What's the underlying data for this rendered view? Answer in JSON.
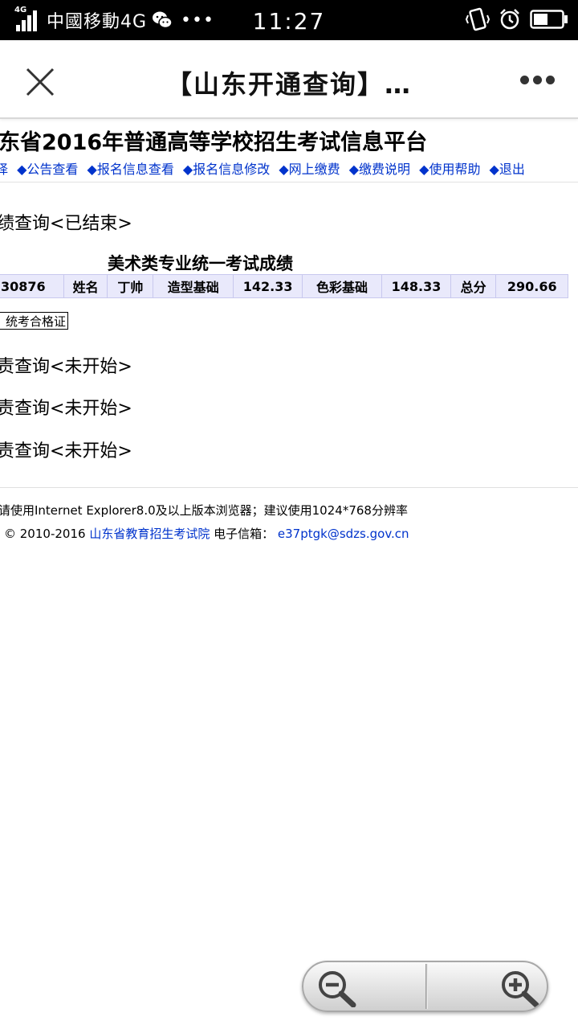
{
  "status_bar": {
    "network_tag": "4G",
    "carrier": "中國移動4G",
    "time": "11:27",
    "icons": [
      "signal-icon",
      "wechat-icon",
      "more-notifications-icon",
      "vibrate-icon",
      "alarm-icon",
      "battery-icon"
    ],
    "battery_level": 0.5
  },
  "title_bar": {
    "title": "【山东开通查询】…",
    "close_icon": "close-icon",
    "menu_icon": "more-icon"
  },
  "page": {
    "site_title": "东省2016年普通高等学校招生考试信息平台",
    "nav": [
      "择",
      "◆公告查看",
      "◆报名信息查看",
      "◆报名信息修改",
      "◆网上缴费",
      "◆缴费说明",
      "◆使用帮助",
      "◆退出"
    ],
    "section1_title": "绩查询<已结束>",
    "score_caption": "美术类专业统一考试成绩",
    "score_row": [
      "30876",
      "姓名",
      "丁帅",
      "造型基础",
      "142.33",
      "色彩基础",
      "148.33",
      "总分",
      "290.66"
    ],
    "cert_button": "统考合格证",
    "section2_title": "责查询<未开始>",
    "section3_title": "责查询<未开始>",
    "section4_title": "责查询<未开始>",
    "footer": {
      "line1": "请使用Internet Explorer8.0及以上版本浏览器；建议使用1024*768分辨率",
      "copyright": "© 2010-2016",
      "org_link": "山东省教育招生考试院",
      "email_label": "电子信箱：",
      "email": "e37ptgk@sdzs.gov.cn"
    }
  },
  "zoom_control": {
    "zoom_out_icon": "zoom-out-icon",
    "zoom_in_icon": "zoom-in-icon"
  },
  "colors": {
    "link": "#0033cc",
    "table_bg": "#e9e9fb",
    "status_bar_bg": "#000000"
  }
}
